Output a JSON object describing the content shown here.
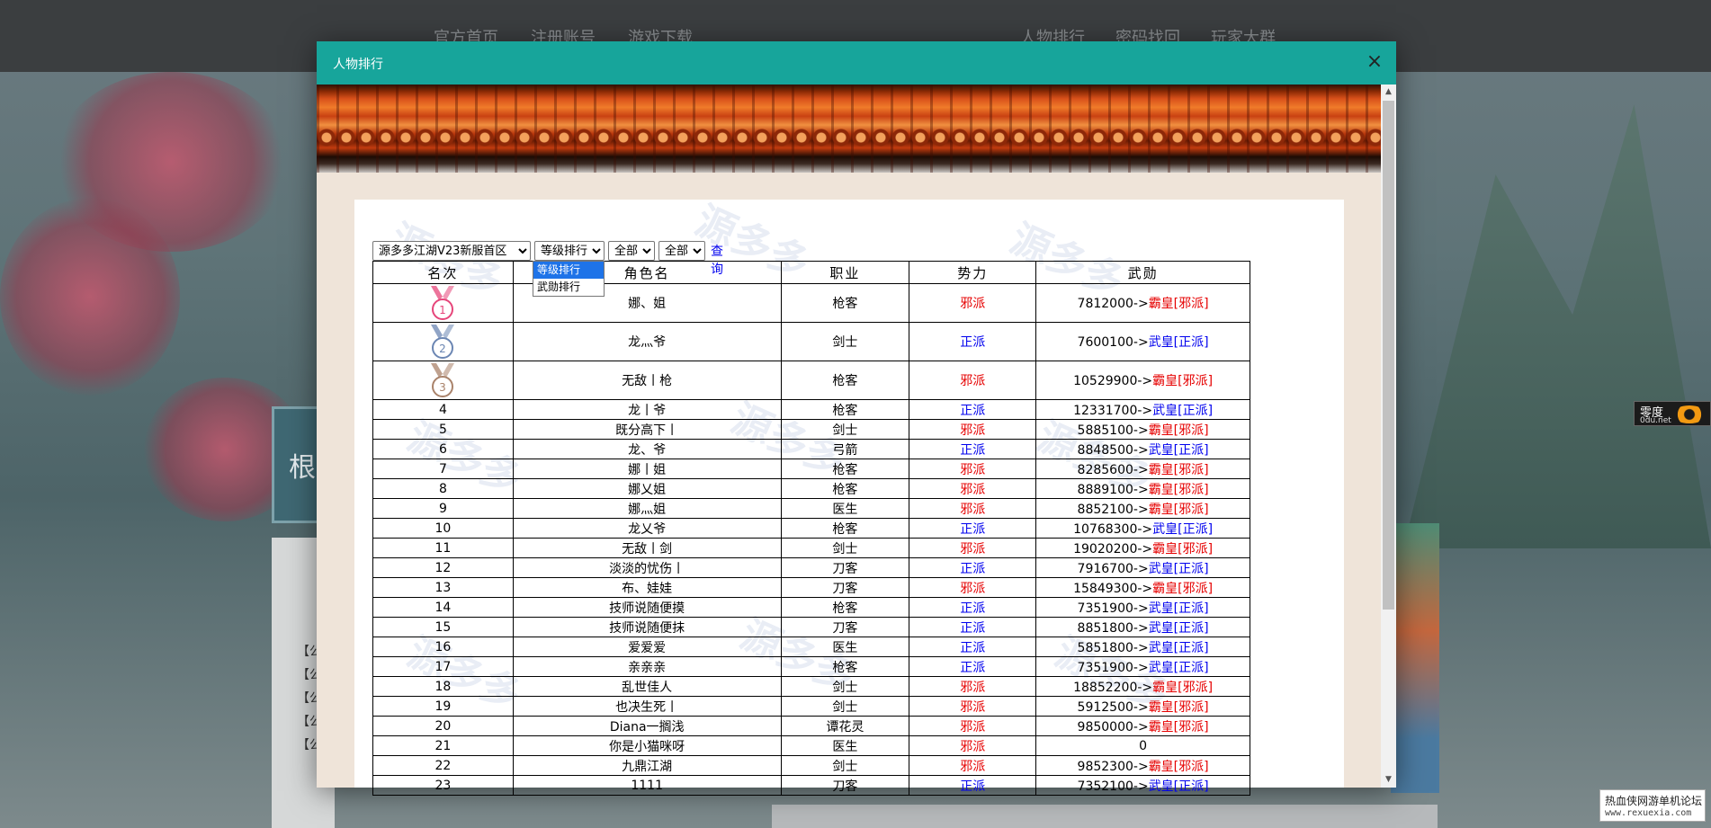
{
  "background": {
    "nav_left": [
      "官方首页",
      "注册账号",
      "游戏下载"
    ],
    "nav_right": [
      "人物排行",
      "密码找回",
      "玩家大群"
    ],
    "sidebar_tags": [
      "【公",
      "【公",
      "【公",
      "【公",
      "【公"
    ],
    "panel_char": "根",
    "odu_badge": {
      "title": "零度",
      "url": "0du.net"
    },
    "forum_badge": {
      "title": "热血侠网游单机论坛",
      "url": "www.rexuexia.com"
    }
  },
  "modal": {
    "title": "人物排行",
    "close_label": "×"
  },
  "controls": {
    "server_select": "源多多江湖V23新服首区",
    "rank_type_select": "等级排行",
    "filter1_select": "全部",
    "filter2_select": "全部",
    "query_label": "查询",
    "dropdown_options": [
      "等级排行",
      "武勋排行"
    ]
  },
  "watermark": {
    "brand": "源多多",
    "url": "www.yuandd.net"
  },
  "table": {
    "headers": [
      "名次",
      "角色名",
      "职业",
      "势力",
      "武勋"
    ],
    "rows": [
      {
        "rank": "1",
        "name": "娜、姐",
        "job": "枪客",
        "faction": "邪派",
        "exp": "7812000->",
        "title": "霸皇[邪派]"
      },
      {
        "rank": "2",
        "name": "龙灬爷",
        "job": "剑士",
        "faction": "正派",
        "exp": "7600100->",
        "title": "武皇[正派]"
      },
      {
        "rank": "3",
        "name": "无敌丨枪",
        "job": "枪客",
        "faction": "邪派",
        "exp": "10529900->",
        "title": "霸皇[邪派]"
      },
      {
        "rank": "4",
        "name": "龙丨爷",
        "job": "枪客",
        "faction": "正派",
        "exp": "12331700->",
        "title": "武皇[正派]"
      },
      {
        "rank": "5",
        "name": "既分高下丨",
        "job": "剑士",
        "faction": "邪派",
        "exp": "5885100->",
        "title": "霸皇[邪派]"
      },
      {
        "rank": "6",
        "name": "龙、爷",
        "job": "弓箭",
        "faction": "正派",
        "exp": "8848500->",
        "title": "武皇[正派]"
      },
      {
        "rank": "7",
        "name": "娜丨姐",
        "job": "枪客",
        "faction": "邪派",
        "exp": "8285600->",
        "title": "霸皇[邪派]"
      },
      {
        "rank": "8",
        "name": "娜乂姐",
        "job": "枪客",
        "faction": "邪派",
        "exp": "8889100->",
        "title": "霸皇[邪派]"
      },
      {
        "rank": "9",
        "name": "娜灬姐",
        "job": "医生",
        "faction": "邪派",
        "exp": "8852100->",
        "title": "霸皇[邪派]"
      },
      {
        "rank": "10",
        "name": "龙乂爷",
        "job": "枪客",
        "faction": "正派",
        "exp": "10768300->",
        "title": "武皇[正派]"
      },
      {
        "rank": "11",
        "name": "无敌丨剑",
        "job": "剑士",
        "faction": "邪派",
        "exp": "19020200->",
        "title": "霸皇[邪派]"
      },
      {
        "rank": "12",
        "name": "淡淡的忧伤丨",
        "job": "刀客",
        "faction": "正派",
        "exp": "7916700->",
        "title": "武皇[正派]"
      },
      {
        "rank": "13",
        "name": "布、娃娃",
        "job": "刀客",
        "faction": "邪派",
        "exp": "15849300->",
        "title": "霸皇[邪派]"
      },
      {
        "rank": "14",
        "name": "技师说随便摸",
        "job": "枪客",
        "faction": "正派",
        "exp": "7351900->",
        "title": "武皇[正派]"
      },
      {
        "rank": "15",
        "name": "技师说随便抹",
        "job": "刀客",
        "faction": "正派",
        "exp": "8851800->",
        "title": "武皇[正派]"
      },
      {
        "rank": "16",
        "name": "爱爱爱",
        "job": "医生",
        "faction": "正派",
        "exp": "5851800->",
        "title": "武皇[正派]"
      },
      {
        "rank": "17",
        "name": "亲亲亲",
        "job": "枪客",
        "faction": "正派",
        "exp": "7351900->",
        "title": "武皇[正派]"
      },
      {
        "rank": "18",
        "name": "乱世佳人",
        "job": "剑士",
        "faction": "邪派",
        "exp": "18852200->",
        "title": "霸皇[邪派]"
      },
      {
        "rank": "19",
        "name": "也决生死丨",
        "job": "剑士",
        "faction": "邪派",
        "exp": "5912500->",
        "title": "霸皇[邪派]"
      },
      {
        "rank": "20",
        "name": "Diana一搁浅",
        "job": "谭花灵",
        "faction": "邪派",
        "exp": "9850000->",
        "title": "霸皇[邪派]"
      },
      {
        "rank": "21",
        "name": "你是小猫咪呀",
        "job": "医生",
        "faction": "邪派",
        "exp": "0",
        "title": ""
      },
      {
        "rank": "22",
        "name": "九鼎江湖",
        "job": "剑士",
        "faction": "邪派",
        "exp": "9852300->",
        "title": "霸皇[邪派]"
      },
      {
        "rank": "23",
        "name": "1111",
        "job": "刀客",
        "faction": "正派",
        "exp": "7352100->",
        "title": "武皇[正派]"
      }
    ]
  },
  "colors": {
    "header_teal": "#17a59b",
    "evil_red": "#e60000",
    "righteous_blue": "#0000ee",
    "medal_1": "#e6457a",
    "medal_2": "#6b86b3",
    "medal_3": "#a9826a"
  }
}
